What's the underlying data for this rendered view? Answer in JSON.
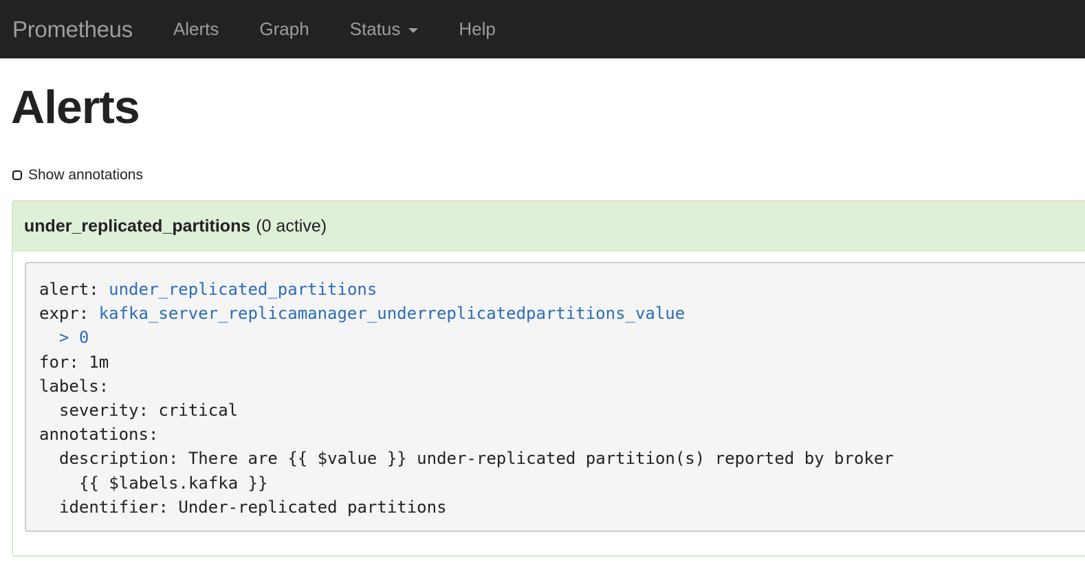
{
  "navbar": {
    "brand": "Prometheus",
    "items": [
      {
        "label": "Alerts"
      },
      {
        "label": "Graph"
      },
      {
        "label": "Status"
      },
      {
        "label": "Help"
      }
    ]
  },
  "page": {
    "title": "Alerts",
    "show_annotations_label": "Show annotations"
  },
  "rule": {
    "name": "under_replicated_partitions",
    "active": "(0 active)",
    "lines": {
      "alert_key": "alert: ",
      "alert_val": "under_replicated_partitions",
      "expr_key": "expr: ",
      "expr_val": "kafka_server_replicamanager_underreplicatedpartitions_value",
      "expr_cont": "> 0",
      "for": "for: 1m",
      "labels": "labels:",
      "severity": "severity: critical",
      "annotations": "annotations:",
      "description": "description: There are {{ $value }} under-replicated partition(s) reported by broker",
      "description_cont": "{{ $labels.kafka }}",
      "identifier": "identifier: Under-replicated partitions"
    }
  },
  "colors": {
    "navbar_bg": "#222222",
    "panel_heading_bg": "#dff0d8",
    "link": "#2b6cb8"
  }
}
